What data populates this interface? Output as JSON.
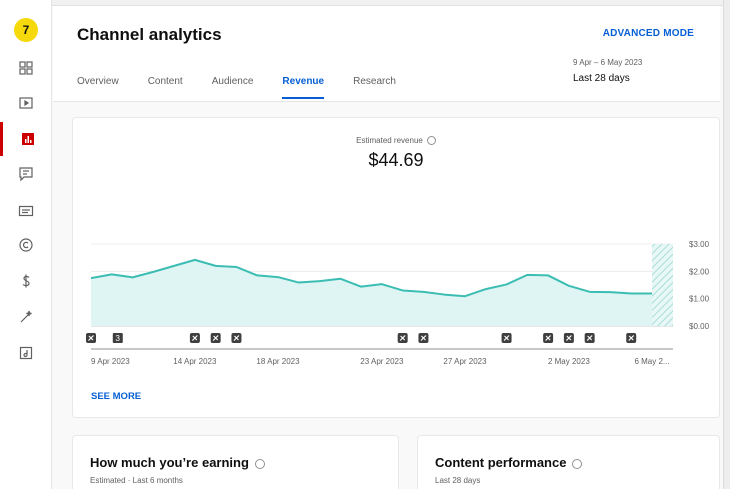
{
  "sidebar": {
    "logo_text": "7",
    "items": [
      {
        "name": "dashboard",
        "icon": "dashboard-icon"
      },
      {
        "name": "content",
        "icon": "video-icon"
      },
      {
        "name": "analytics",
        "icon": "analytics-icon",
        "active": true
      },
      {
        "name": "comments",
        "icon": "comments-icon"
      },
      {
        "name": "subtitles",
        "icon": "subtitles-icon"
      },
      {
        "name": "copyright",
        "icon": "copyright-icon"
      },
      {
        "name": "earn",
        "icon": "dollar-icon"
      },
      {
        "name": "customisation",
        "icon": "magic-wand-icon"
      },
      {
        "name": "audio-library",
        "icon": "audio-library-icon"
      }
    ],
    "accent": "#cc0000"
  },
  "header": {
    "title": "Channel analytics",
    "advanced_mode": "ADVANCED MODE",
    "tabs": [
      "Overview",
      "Content",
      "Audience",
      "Revenue",
      "Research"
    ],
    "active_tab": "Revenue",
    "date_range": "9 Apr – 6 May 2023",
    "date_label": "Last 28 days"
  },
  "revenue": {
    "metric_label": "Estimated revenue",
    "metric_value": "$44.69",
    "see_more": "SEE MORE"
  },
  "chart_data": {
    "type": "area",
    "x": [
      "9 Apr",
      "10 Apr",
      "11 Apr",
      "12 Apr",
      "13 Apr",
      "14 Apr",
      "15 Apr",
      "16 Apr",
      "17 Apr",
      "18 Apr",
      "19 Apr",
      "20 Apr",
      "21 Apr",
      "22 Apr",
      "23 Apr",
      "24 Apr",
      "25 Apr",
      "26 Apr",
      "27 Apr",
      "28 Apr",
      "29 Apr",
      "30 Apr",
      "1 May",
      "2 May",
      "3 May",
      "4 May",
      "5 May",
      "6 May"
    ],
    "series": [
      {
        "values": [
          1.75,
          1.89,
          1.78,
          1.98,
          2.2,
          2.42,
          2.2,
          2.16,
          1.85,
          1.79,
          1.59,
          1.64,
          1.73,
          1.44,
          1.53,
          1.3,
          1.25,
          1.15,
          1.09,
          1.35,
          1.52,
          1.87,
          1.85,
          1.47,
          1.25,
          1.24,
          1.19,
          1.19
        ]
      }
    ],
    "y_ticks": [
      "$3.00",
      "$2.00",
      "$1.00",
      "$0.00"
    ],
    "ylim": [
      0,
      3
    ],
    "x_tick_labels": [
      "9 Apr 2023",
      "14 Apr 2023",
      "18 Apr 2023",
      "23 Apr 2023",
      "27 Apr 2023",
      "2 May 2023",
      "6 May 2..."
    ],
    "x_tick_indices": [
      0,
      5,
      9,
      14,
      18,
      23,
      27
    ],
    "marker_indices": [
      0,
      5,
      6,
      7,
      15,
      16,
      20,
      22,
      23,
      24,
      26
    ],
    "special_marker_index": 1,
    "special_marker_text": "3",
    "incomplete_last_day": true,
    "line_color": "#3cbdb3",
    "fill_color": "#dff5f3"
  },
  "cards": [
    {
      "title": "How much you’re earning",
      "subtitle": "Estimated · Last 6 months"
    },
    {
      "title": "Content performance",
      "subtitle": "Last 28 days"
    }
  ]
}
